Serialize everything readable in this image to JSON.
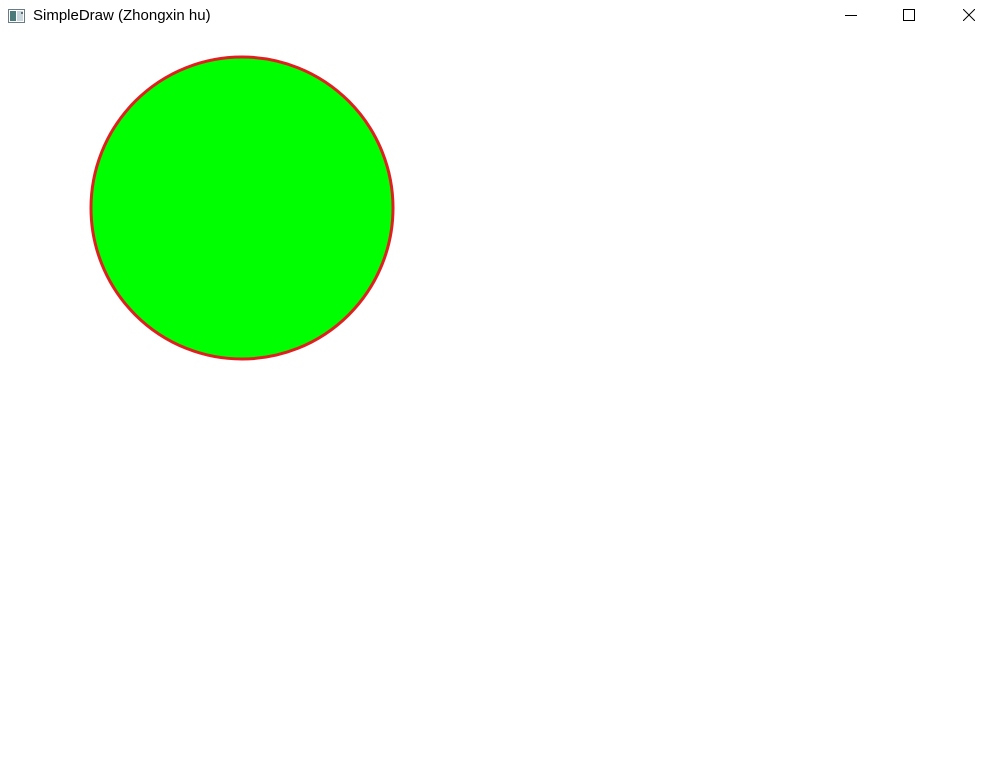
{
  "window": {
    "title": "SimpleDraw (Zhongxin hu)",
    "app_icon": "window-app-icon",
    "controls": {
      "minimize_icon": "minimize-icon",
      "maximize_icon": "maximize-icon",
      "close_icon": "close-icon"
    }
  },
  "canvas": {
    "background": "#ffffff",
    "shapes": [
      {
        "type": "circle",
        "fill": "#00ff00",
        "stroke": "#e02020"
      }
    ]
  }
}
